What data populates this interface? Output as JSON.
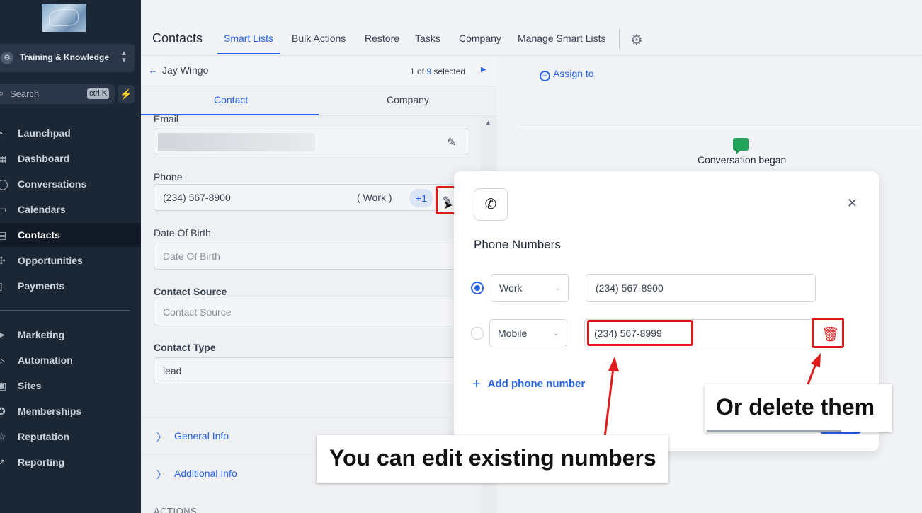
{
  "sidebar": {
    "account": "Training & Knowledge",
    "search": {
      "placeholder": "Search",
      "shortcut": "ctrl K"
    },
    "items": [
      {
        "label": "Launchpad",
        "icon": "rocket-icon"
      },
      {
        "label": "Dashboard",
        "icon": "grid-icon"
      },
      {
        "label": "Conversations",
        "icon": "chat-icon"
      },
      {
        "label": "Calendars",
        "icon": "calendar-icon"
      },
      {
        "label": "Contacts",
        "icon": "contacts-icon",
        "active": true
      },
      {
        "label": "Opportunities",
        "icon": "opportunities-icon"
      },
      {
        "label": "Payments",
        "icon": "payments-icon"
      },
      {
        "label": "Marketing",
        "icon": "send-icon"
      },
      {
        "label": "Automation",
        "icon": "automation-icon"
      },
      {
        "label": "Sites",
        "icon": "sites-icon"
      },
      {
        "label": "Memberships",
        "icon": "memberships-icon"
      },
      {
        "label": "Reputation",
        "icon": "star-icon"
      },
      {
        "label": "Reporting",
        "icon": "chart-icon"
      }
    ]
  },
  "header": {
    "title": "Contacts",
    "tabs": [
      "Smart Lists",
      "Bulk Actions",
      "Restore",
      "Tasks",
      "Company",
      "Manage Smart Lists"
    ],
    "active_tab": "Smart Lists"
  },
  "contact_panel": {
    "name": "Jay Wingo",
    "position_prefix": "1 of",
    "position_total": "9",
    "position_suffix": "selected",
    "tabs": [
      "Contact",
      "Company"
    ],
    "fields": {
      "email_label": "Email",
      "phone_label": "Phone",
      "phone_value": "(234) 567-8900",
      "phone_type": "( Work )",
      "phone_extra": "+1",
      "dob_label": "Date Of Birth",
      "dob_placeholder": "Date Of Birth",
      "source_label": "Contact Source",
      "source_placeholder": "Contact Source",
      "type_label": "Contact Type",
      "type_value": "lead"
    },
    "sections": [
      "General Info",
      "Additional Info"
    ],
    "actions_label": "ACTIONS"
  },
  "activity": {
    "assign_label": "Assign to",
    "conversation_label": "Conversation began"
  },
  "modal": {
    "title": "Phone Numbers",
    "rows": [
      {
        "type": "Work",
        "number": "(234) 567-8900",
        "selected": true
      },
      {
        "type": "Mobile",
        "number": "(234) 567-8999",
        "selected": false
      }
    ],
    "add_label": "Add phone number"
  },
  "annotations": {
    "edit": "You can edit existing numbers",
    "delete": "Or delete them",
    "highlight_color": "#e01b1b"
  },
  "colors": {
    "accent": "#2563eb",
    "sidebar": "#1c2736"
  }
}
